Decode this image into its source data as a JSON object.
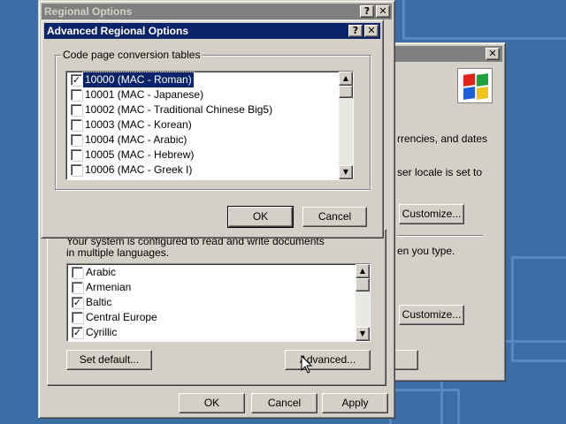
{
  "background_window": {
    "close_glyph": "✕",
    "text_line_1": "rrencies, and dates",
    "text_line_2": "ser locale is set to",
    "text_line_3": "en you type.",
    "customize_button_1": "Customize...",
    "customize_button_2": "Customize..."
  },
  "regional_options": {
    "title": "Regional Options",
    "help_glyph": "?",
    "close_glyph": "✕",
    "description": "Your system is configured to read and write documents in multiple languages.",
    "languages": [
      {
        "label": "Arabic",
        "checked": false
      },
      {
        "label": "Armenian",
        "checked": false
      },
      {
        "label": "Baltic",
        "checked": true
      },
      {
        "label": "Central Europe",
        "checked": false
      },
      {
        "label": "Cyrillic",
        "checked": true
      }
    ],
    "set_default_button": "Set default...",
    "advanced_button": "Advanced...",
    "ok_button": "OK",
    "cancel_button": "Cancel",
    "apply_button": "Apply"
  },
  "advanced_dialog": {
    "title": "Advanced Regional Options",
    "help_glyph": "?",
    "close_glyph": "✕",
    "group_label": "Code page conversion tables",
    "code_pages": [
      {
        "label": "10000 (MAC - Roman)",
        "checked": true,
        "selected": true
      },
      {
        "label": "10001 (MAC - Japanese)",
        "checked": false,
        "selected": false
      },
      {
        "label": "10002 (MAC - Traditional Chinese Big5)",
        "checked": false,
        "selected": false
      },
      {
        "label": "10003 (MAC - Korean)",
        "checked": false,
        "selected": false
      },
      {
        "label": "10004 (MAC - Arabic)",
        "checked": false,
        "selected": false
      },
      {
        "label": "10005 (MAC - Hebrew)",
        "checked": false,
        "selected": false
      },
      {
        "label": "10006 (MAC - Greek I)",
        "checked": false,
        "selected": false
      }
    ],
    "ok_button": "OK",
    "cancel_button": "Cancel"
  },
  "scroll_glyphs": {
    "up": "▲",
    "down": "▼"
  },
  "check_glyph": "✓",
  "colors": {
    "desktop": "#3a6ea5",
    "active_title": "#0a246a",
    "inactive_title": "#808080",
    "face": "#d4d0c8",
    "selection": "#0a246a"
  }
}
